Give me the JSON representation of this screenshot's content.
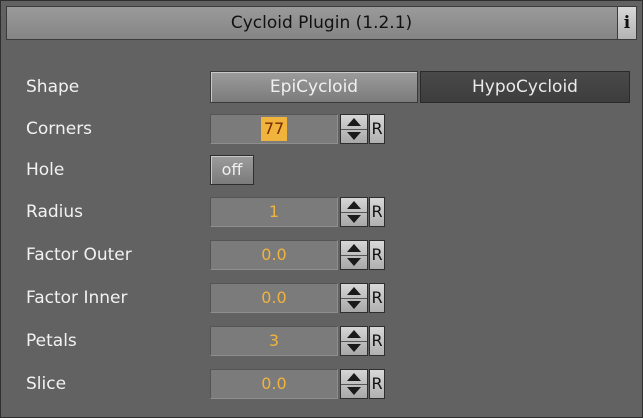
{
  "window": {
    "title": "Cycloid Plugin (1.2.1)",
    "info_label": "i"
  },
  "shape": {
    "label": "Shape",
    "options": [
      "EpiCycloid",
      "HypoCycloid"
    ],
    "selected": "HypoCycloid"
  },
  "corners": {
    "label": "Corners",
    "value": "77",
    "reset_label": "R"
  },
  "hole": {
    "label": "Hole",
    "value": "off"
  },
  "radius": {
    "label": "Radius",
    "value": "1",
    "reset_label": "R"
  },
  "factor_outer": {
    "label": "Factor Outer",
    "value": "0.0",
    "reset_label": "R"
  },
  "factor_inner": {
    "label": "Factor Inner",
    "value": "0.0",
    "reset_label": "R"
  },
  "petals": {
    "label": "Petals",
    "value": "3",
    "reset_label": "R"
  },
  "slice": {
    "label": "Slice",
    "value": "0.0",
    "reset_label": "R"
  },
  "colors": {
    "panel_bg": "#626262",
    "value_text": "#f0b33c",
    "label_text": "#f2f2f2"
  }
}
